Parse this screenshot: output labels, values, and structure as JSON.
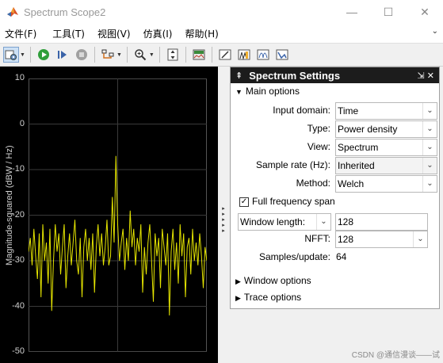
{
  "window": {
    "title": "Spectrum Scope2",
    "minimize": "—",
    "maximize": "☐",
    "close": "✕"
  },
  "menu": [
    "文件(F)",
    "工具(T)",
    "视图(V)",
    "仿真(I)",
    "帮助(H)"
  ],
  "menu_overflow": "⌄",
  "toolbar": {
    "buttons": [
      "config-properties",
      "run",
      "step-forward",
      "stop",
      "highlight",
      "zoom-in",
      "scale-y-axes",
      "spectrum-view",
      "measure-1",
      "measure-2",
      "measure-3",
      "measure-4"
    ]
  },
  "plot": {
    "ylabel": "Magnitude-squared (dBW / Hz)",
    "yticks": [
      "10",
      "0",
      "-10",
      "-20",
      "-30",
      "-40",
      "-50"
    ],
    "colors": {
      "trace": "#e5e500",
      "grid": "#3a3a3a",
      "background": "#000000"
    }
  },
  "chart_data": {
    "type": "line",
    "xlabel": "",
    "ylabel": "Magnitude-squared (dBW / Hz)",
    "ylim": [
      -50,
      10
    ],
    "grid": true,
    "series": [
      {
        "values": [
          -28,
          -25,
          -31,
          -23,
          -29,
          -34,
          -24,
          -38,
          -22,
          -30,
          -26,
          -35,
          -23,
          -41,
          -30,
          -22,
          -28,
          -24,
          -33,
          -27,
          -22,
          -36,
          -29,
          -24,
          -31,
          -26,
          -21,
          -30,
          -33,
          -25,
          -38,
          -27,
          -23,
          -30,
          -25,
          -32,
          -24,
          -37,
          -27,
          -22,
          -29,
          -24,
          -31,
          -27,
          -21,
          -31,
          -29,
          -16,
          -26,
          -7,
          -22,
          -30,
          -26,
          -23,
          -32,
          -25,
          -30,
          -19,
          -27,
          -23,
          -31,
          -25,
          -28,
          -22,
          -37,
          -27,
          -33,
          -26,
          -22,
          -30,
          -39,
          -24,
          -29,
          -25,
          -36,
          -23,
          -27,
          -31,
          -24,
          -42,
          -28,
          -23,
          -32,
          -26,
          -35,
          -22,
          -29,
          -24,
          -38,
          -27,
          -25,
          -33,
          -23,
          -30,
          -26,
          -31,
          -24,
          -29,
          -36,
          -27,
          -30
        ]
      }
    ]
  },
  "settings": {
    "title": "Spectrum Settings",
    "main_options": "Main options",
    "input_domain_label": "Input domain:",
    "input_domain_value": "Time",
    "type_label": "Type:",
    "type_value": "Power density",
    "view_label": "View:",
    "view_value": "Spectrum",
    "sample_rate_label": "Sample rate (Hz):",
    "sample_rate_value": "Inherited",
    "method_label": "Method:",
    "method_value": "Welch",
    "full_freq_label": "Full frequency span",
    "full_freq_checked": true,
    "window_length_label": "Window length:",
    "window_length_value": "128",
    "nfft_label": "NFFT:",
    "nfft_value": "128",
    "samples_update_label": "Samples/update:",
    "samples_update_value": "64",
    "window_options": "Window options",
    "trace_options": "Trace options"
  },
  "watermark": "CSDN @通信漫谈——试"
}
